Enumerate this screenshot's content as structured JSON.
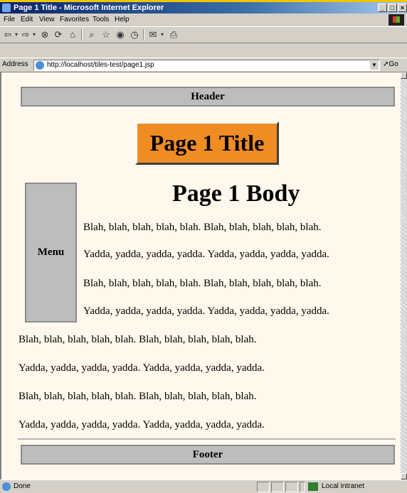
{
  "window": {
    "title": "Page 1 Title - Microsoft Internet Explorer",
    "buttons": [
      "_",
      "□",
      "×"
    ]
  },
  "menu": [
    "File",
    "Edit",
    "View",
    "Favorites",
    "Tools",
    "Help"
  ],
  "toolbar": {
    "icons": [
      "back-icon",
      "forward-icon",
      "stop-icon",
      "refresh-icon",
      "home-icon",
      "search-icon",
      "favorites-icon",
      "history-icon",
      "media-icon",
      "mail-icon",
      "print-icon"
    ]
  },
  "address": {
    "label": "Address",
    "url": "http://localhost/tiles-test/page1.jsp",
    "go_label": "Go"
  },
  "page": {
    "header": "Header",
    "title": "Page 1 Title",
    "menu": "Menu",
    "body_title": "Page 1 Body",
    "paragraphs": [
      "Blah, blah, blah, blah, blah. Blah, blah, blah, blah, blah.",
      "Yadda, yadda, yadda, yadda. Yadda, yadda, yadda, yadda.",
      "Blah, blah, blah, blah, blah. Blah, blah, blah, blah, blah.",
      "Yadda, yadda, yadda, yadda. Yadda, yadda, yadda, yadda.",
      "Blah, blah, blah, blah, blah. Blah, blah, blah, blah, blah.",
      "Yadda, yadda, yadda, yadda. Yadda, yadda, yadda, yadda.",
      "Blah, blah, blah, blah, blah. Blah, blah, blah, blah, blah.",
      "Yadda, yadda, yadda, yadda. Yadda, yadda, yadda, yadda."
    ],
    "footer": "Footer"
  },
  "status": {
    "text": "Done",
    "zone": "Local intranet"
  },
  "colors": {
    "title_bg": "#f08c24",
    "page_bg": "#fff8ec",
    "box_bg": "#bdbdbd"
  }
}
